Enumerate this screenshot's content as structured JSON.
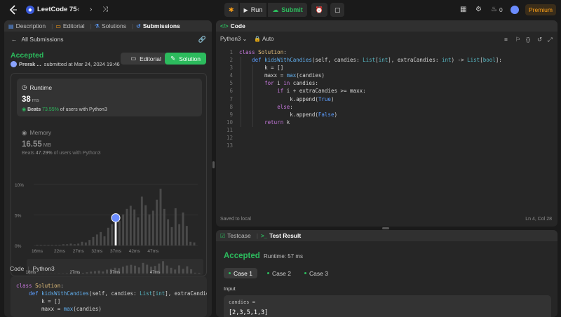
{
  "topbar": {
    "study_title": "LeetCode 75",
    "run_label": "Run",
    "submit_label": "Submit",
    "streak_count": "0",
    "premium_label": "Premium"
  },
  "left": {
    "tabs": [
      {
        "label": "Description"
      },
      {
        "label": "Editorial"
      },
      {
        "label": "Solutions"
      },
      {
        "label": "Submissions"
      }
    ],
    "back_label": "All Submissions",
    "status": "Accepted",
    "author": "Prerak ...",
    "submitted": "submitted at Mar 24, 2024 19:46",
    "editorial_button": "Editorial",
    "solution_button": "Solution",
    "runtime": {
      "title": "Runtime",
      "value": "38",
      "unit": "ms",
      "beats_prefix": "Beats",
      "beats_pct": "73.55%",
      "beats_suffix": "of users with Python3"
    },
    "memory": {
      "title": "Memory",
      "value": "16.55",
      "unit": "MB",
      "beats_prefix": "Beats",
      "beats_pct": "47.29%",
      "beats_suffix": "of users with Python3"
    },
    "code_label": "Code",
    "code_lang": "Python3"
  },
  "chart_data": {
    "type": "bar",
    "y_ticks": [
      "10%",
      "5%",
      "0%"
    ],
    "ylim": [
      0,
      10
    ],
    "x_ticks": [
      "16ms",
      "22ms",
      "27ms",
      "32ms",
      "37ms",
      "42ms",
      "47ms"
    ],
    "mini_x_ticks": [
      "16ms",
      "27ms",
      "37ms",
      "47ms"
    ],
    "x_start": 16,
    "x_step": 1,
    "values": [
      0.1,
      0.1,
      0.1,
      0.1,
      0.1,
      0.1,
      0.1,
      0.2,
      0.2,
      0.3,
      0.2,
      0.3,
      0.6,
      0.5,
      0.9,
      1.4,
      1.8,
      2.2,
      1.5,
      2.9,
      3.5,
      4.3,
      4.0,
      5.1,
      6.0,
      6.5,
      5.9,
      4.6,
      8.0,
      6.6,
      5.1,
      5.7,
      7.5,
      9.3,
      6.0,
      4.3,
      3.0,
      6.1,
      3.5,
      5.4,
      3.2,
      0.6,
      0.5
    ],
    "highlight": {
      "x": 37,
      "label": "37ms"
    }
  },
  "editor": {
    "title": "Code",
    "language": "Python3",
    "auto_label": "Auto",
    "saved_label": "Saved to local",
    "cursor": "Ln 4, Col 28",
    "line_numbers": [
      "1",
      "2",
      "3",
      "4",
      "5",
      "6",
      "7",
      "8",
      "9",
      "10",
      "11",
      "12",
      "13"
    ]
  },
  "test": {
    "tabs": [
      {
        "label": "Testcase"
      },
      {
        "label": "Test Result"
      }
    ],
    "status": "Accepted",
    "runtime": "Runtime: 57 ms",
    "cases": [
      {
        "label": "Case 1"
      },
      {
        "label": "Case 2"
      },
      {
        "label": "Case 3"
      }
    ],
    "input_label": "Input",
    "var_name": "candies =",
    "var_value": "[2,3,5,1,3]"
  },
  "colors": {
    "accent": "#2cbb5d",
    "premium": "#ffa116",
    "bar": "#4a4a4a",
    "highlight": "#ffffff"
  }
}
